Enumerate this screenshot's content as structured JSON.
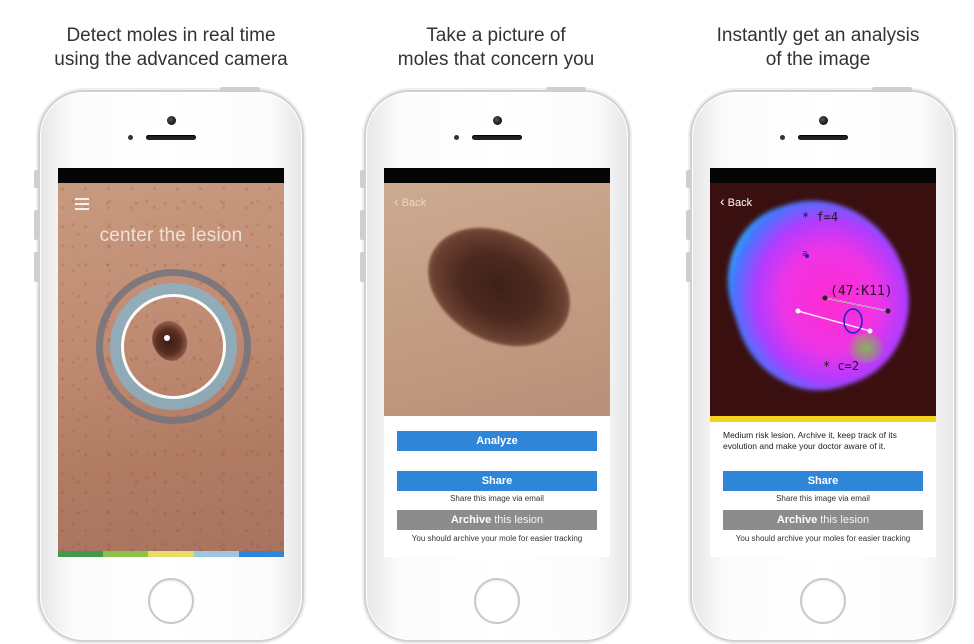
{
  "captions": [
    {
      "line1": "Detect moles in real time",
      "line2": "using the advanced camera"
    },
    {
      "line1": "Take a picture of",
      "line2": "moles that concern you"
    },
    {
      "line1": "Instantly get an analysis",
      "line2": "of the image"
    }
  ],
  "camera_screen": {
    "instruction": "center the lesion",
    "color_bar": [
      "#3f9a4c",
      "#8bc34a",
      "#e6dc6a",
      "#9bc7e0",
      "#2f86d8"
    ]
  },
  "photo_screen": {
    "back_label": "Back",
    "analyze_button": "Analyze",
    "share_button": "Share",
    "share_note": "Share this image via email",
    "archive_button_bold": "Archive",
    "archive_button_light": "this lesion",
    "archive_note": "You should archive your mole for easier tracking"
  },
  "analysis_screen": {
    "back_label": "Back",
    "annotation_f": "* f=4",
    "annotation_a": "a",
    "annotation_coords": "(47:K11)",
    "annotation_c": "* c=2",
    "risk_color": "#f4d31c",
    "result_text": "Medium risk lesion. Archive it, keep track of its evolution and make your doctor aware of it.",
    "share_button": "Share",
    "share_note": "Share this image via email",
    "archive_button_bold": "Archive",
    "archive_button_light": "this lesion",
    "archive_note": "You should archive your moles for easier tracking"
  }
}
